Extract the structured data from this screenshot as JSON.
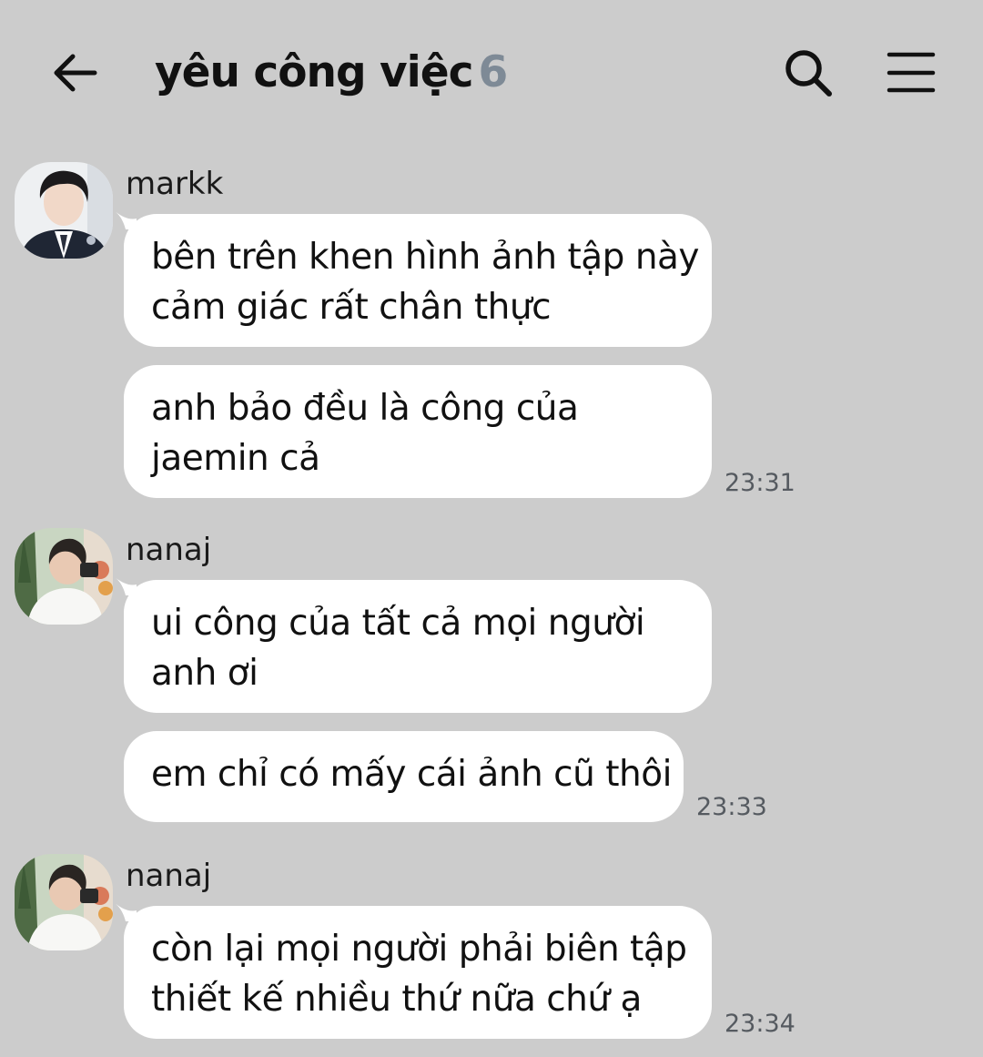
{
  "header": {
    "title": "yêu công việc",
    "member_count": "6",
    "icons": {
      "back": "arrow-left-icon",
      "search": "search-icon",
      "menu": "hamburger-menu-icon"
    }
  },
  "messages": [
    {
      "sender": "markk",
      "avatar_icon": "avatar-markk",
      "bubbles": [
        {
          "lines": [
            "bên trên khen hình ảnh tập này",
            "cảm giác rất chân thực"
          ]
        },
        {
          "lines": [
            "anh bảo đều là công của",
            "jaemin cả"
          ]
        }
      ],
      "time": "23:31"
    },
    {
      "sender": "nanaj",
      "avatar_icon": "avatar-nanaj",
      "bubbles": [
        {
          "lines": [
            "ui công của tất cả mọi người",
            "anh ơi"
          ]
        },
        {
          "lines": [
            "em chỉ có mấy cái ảnh cũ thôi"
          ]
        }
      ],
      "time": "23:33"
    },
    {
      "sender": "nanaj",
      "avatar_icon": "avatar-nanaj",
      "bubbles": [
        {
          "lines": [
            "còn lại mọi người phải biên tập",
            "thiết kế nhiều thứ nữa chứ ạ"
          ]
        }
      ],
      "time": "23:34"
    }
  ],
  "colors": {
    "background": "#cccccc",
    "bubble": "#ffffff",
    "count": "#7e8a96",
    "timestamp": "#555a60"
  }
}
